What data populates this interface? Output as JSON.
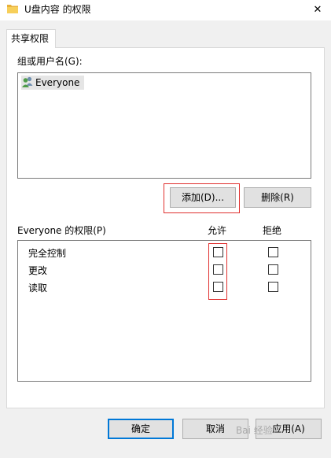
{
  "window": {
    "title": "U盘内容 的权限",
    "close_glyph": "✕"
  },
  "tab": {
    "label": "共享权限"
  },
  "groups": {
    "label": "组或用户名(G):",
    "items": [
      {
        "name": "Everyone",
        "icon": "user-group-icon"
      }
    ]
  },
  "buttons": {
    "add": "添加(D)...",
    "remove": "删除(R)",
    "ok": "确定",
    "cancel": "取消",
    "apply": "应用(A)"
  },
  "permissions": {
    "label": "Everyone 的权限(P)",
    "allow_header": "允许",
    "deny_header": "拒绝",
    "rows": [
      {
        "name": "完全控制",
        "allow": false,
        "deny": false
      },
      {
        "name": "更改",
        "allow": false,
        "deny": false
      },
      {
        "name": "读取",
        "allow": false,
        "deny": false
      }
    ]
  },
  "watermark": "Bai 经验",
  "colors": {
    "highlight": "#e0302f",
    "accent": "#0078d7"
  }
}
